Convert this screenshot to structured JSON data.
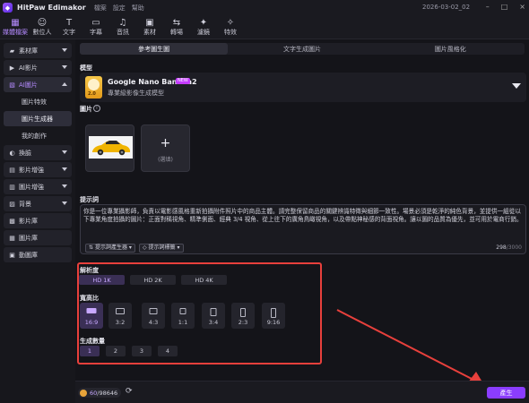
{
  "app": {
    "title": "HitPaw Edimakor",
    "menu": [
      "檔案",
      "設定",
      "幫助"
    ],
    "window_title": "2026-03-02_02"
  },
  "toolbar": [
    {
      "label": "媒體檔案",
      "icon": "media-grid-icon",
      "active": true
    },
    {
      "label": "數位人",
      "icon": "avatar-person-icon",
      "active": false
    },
    {
      "label": "文字",
      "icon": "text-icon",
      "active": false
    },
    {
      "label": "字幕",
      "icon": "caption-icon",
      "active": false
    },
    {
      "label": "音訊",
      "icon": "music-note-icon",
      "active": false
    },
    {
      "label": "素材",
      "icon": "asset-cube-icon",
      "active": false
    },
    {
      "label": "轉場",
      "icon": "transition-arrows-icon",
      "active": false
    },
    {
      "label": "濾鏡",
      "icon": "filter-sparkle-icon",
      "active": false
    },
    {
      "label": "特效",
      "icon": "effects-star-icon",
      "active": false
    }
  ],
  "sidebar": {
    "items": [
      {
        "label": "素材庫",
        "icon": "folder-icon",
        "expandable": true
      },
      {
        "label": "AI影片",
        "icon": "ai-video-icon",
        "expandable": true
      },
      {
        "label": "AI圖片",
        "icon": "ai-image-icon",
        "expandable": true,
        "open": true
      },
      {
        "label": "換臉",
        "icon": "face-swap-icon",
        "expandable": true
      },
      {
        "label": "影片增強",
        "icon": "video-enhance-icon",
        "expandable": true
      },
      {
        "label": "圖片增強",
        "icon": "image-enhance-icon",
        "expandable": true
      },
      {
        "label": "背景",
        "icon": "background-icon",
        "expandable": true
      },
      {
        "label": "影片庫",
        "icon": "video-library-icon",
        "expandable": false
      },
      {
        "label": "圖片庫",
        "icon": "image-library-icon",
        "expandable": false
      },
      {
        "label": "動圖庫",
        "icon": "gif-library-icon",
        "expandable": false
      }
    ],
    "sub_items": [
      {
        "label": "圖片特效",
        "active": false
      },
      {
        "label": "圖片生成器",
        "active": true
      },
      {
        "label": "我的創作",
        "active": false
      }
    ]
  },
  "tabs": [
    {
      "label": "參考圖生圖",
      "active": true
    },
    {
      "label": "文字生成圖片",
      "active": false
    },
    {
      "label": "圖片風格化",
      "active": false
    }
  ],
  "model": {
    "section_label": "模型",
    "name": "Google Nano Banana2",
    "badge": "NEW",
    "thumb_tag": "2.0",
    "description": "專業級影像生成模型"
  },
  "images": {
    "section_label": "圖片",
    "info_glyph": "i",
    "add_plus": "+",
    "add_label": "(選填)"
  },
  "prompt": {
    "section_label": "提示詞",
    "text": "你是一位專業攝影師，負責以電影感風格重新拍攝附件照片中的商品主體。請完整保留商品的關鍵辨識特徵與細節一致性。場景必須是乾淨的純色背景，並提供一組從以下專業角度拍攝的圖片：正面對稱視角、精準側面、經典 3/4 視角、從上往下的廣角鳥瞰視角，以及帶點神秘感的背面視角。讓以圖的品質為優先，並可用於電商行銷。",
    "btn_generator": "提示詞產生器",
    "btn_tags": "提示詞標籤",
    "count_used": "298",
    "count_max": "/3000"
  },
  "resolution": {
    "section_label": "解析度",
    "options": [
      "HD 1K",
      "HD 2K",
      "HD 4K"
    ],
    "selected": "HD 1K"
  },
  "aspect_ratio": {
    "section_label": "寬高比",
    "options": [
      "16:9",
      "3:2",
      "4:3",
      "1:1",
      "3:4",
      "2:3",
      "9:16"
    ],
    "selected": "16:9"
  },
  "quantity": {
    "section_label": "生成數量",
    "options": [
      "1",
      "2",
      "3",
      "4"
    ],
    "selected": "1"
  },
  "footer": {
    "credits_used": "60",
    "credits_total": "/98646",
    "generate_label": "產生"
  },
  "colors": {
    "accent": "#8b3dff",
    "highlight_frame": "#e8403c",
    "coin": "#e8a43a"
  }
}
